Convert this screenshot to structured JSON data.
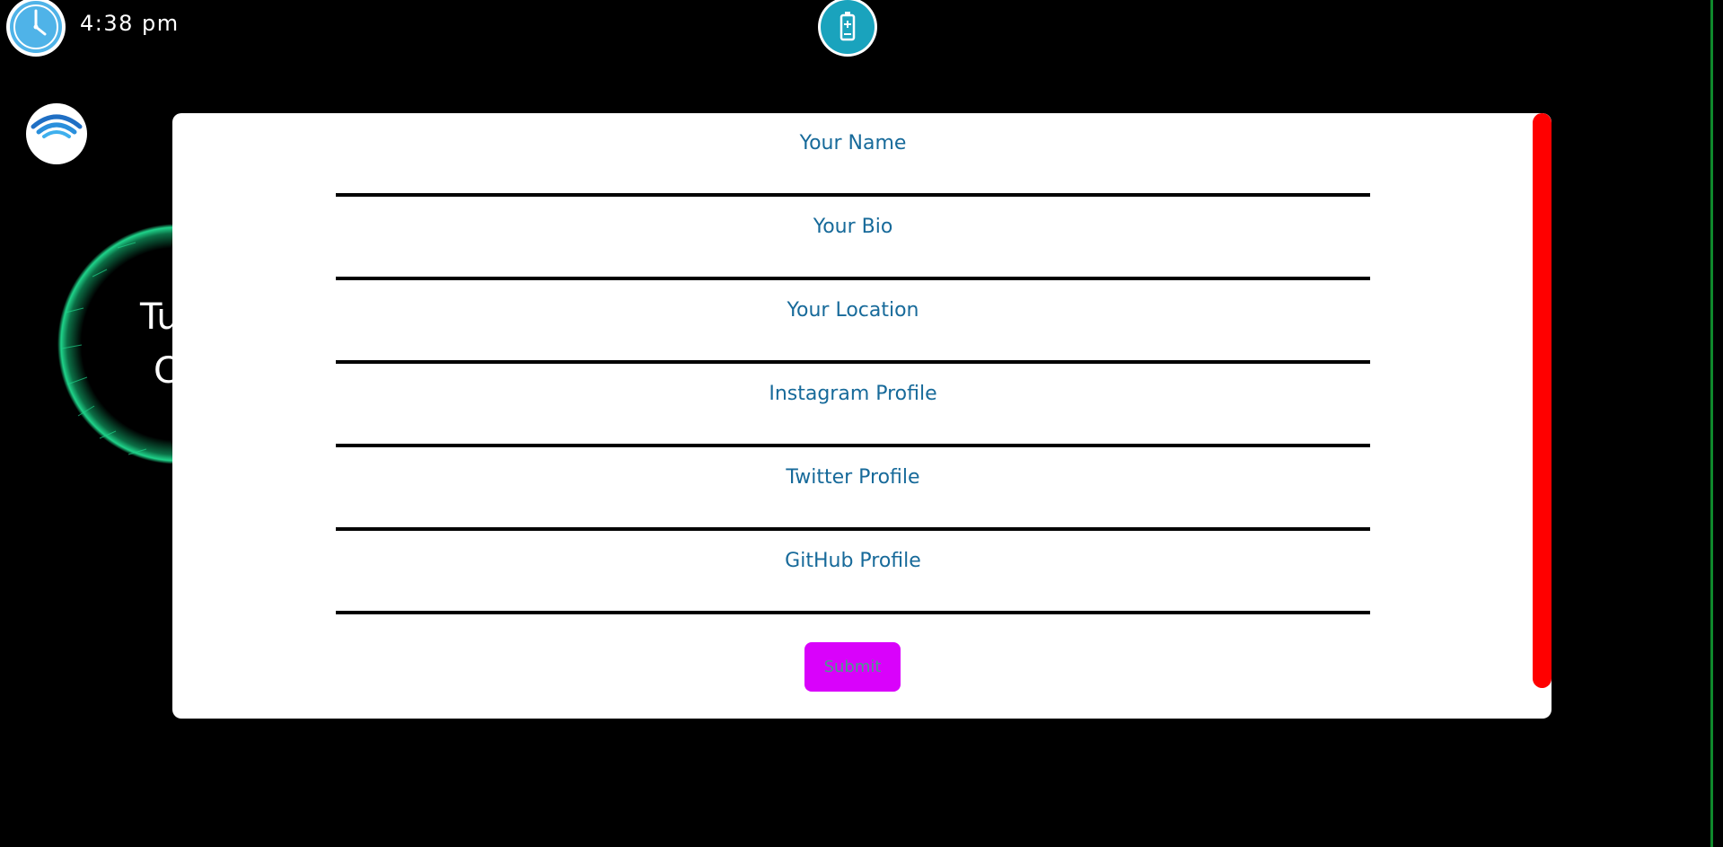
{
  "status_bar": {
    "time": "4:38 pm",
    "clock_icon": "clock-icon",
    "battery_icon": "battery-charging-icon"
  },
  "background": {
    "logo_icon": "wifi-logo-icon",
    "orb_text_line1": "Tu",
    "orb_text_line2": "C"
  },
  "form": {
    "fields": [
      {
        "placeholder": "Your Name",
        "value": ""
      },
      {
        "placeholder": "Your Bio",
        "value": ""
      },
      {
        "placeholder": "Your Location",
        "value": ""
      },
      {
        "placeholder": "Instagram Profile",
        "value": ""
      },
      {
        "placeholder": "Twitter Profile",
        "value": ""
      },
      {
        "placeholder": "GitHub Profile",
        "value": ""
      }
    ],
    "submit_label": "Submit"
  },
  "colors": {
    "accent_submit": "#d902fb",
    "scrollbar": "#ff0000",
    "field_text": "#176a9a",
    "clock_blue": "#4fb3e8",
    "battery_teal": "#1aa3bd",
    "orb_green": "#1fd38a"
  }
}
